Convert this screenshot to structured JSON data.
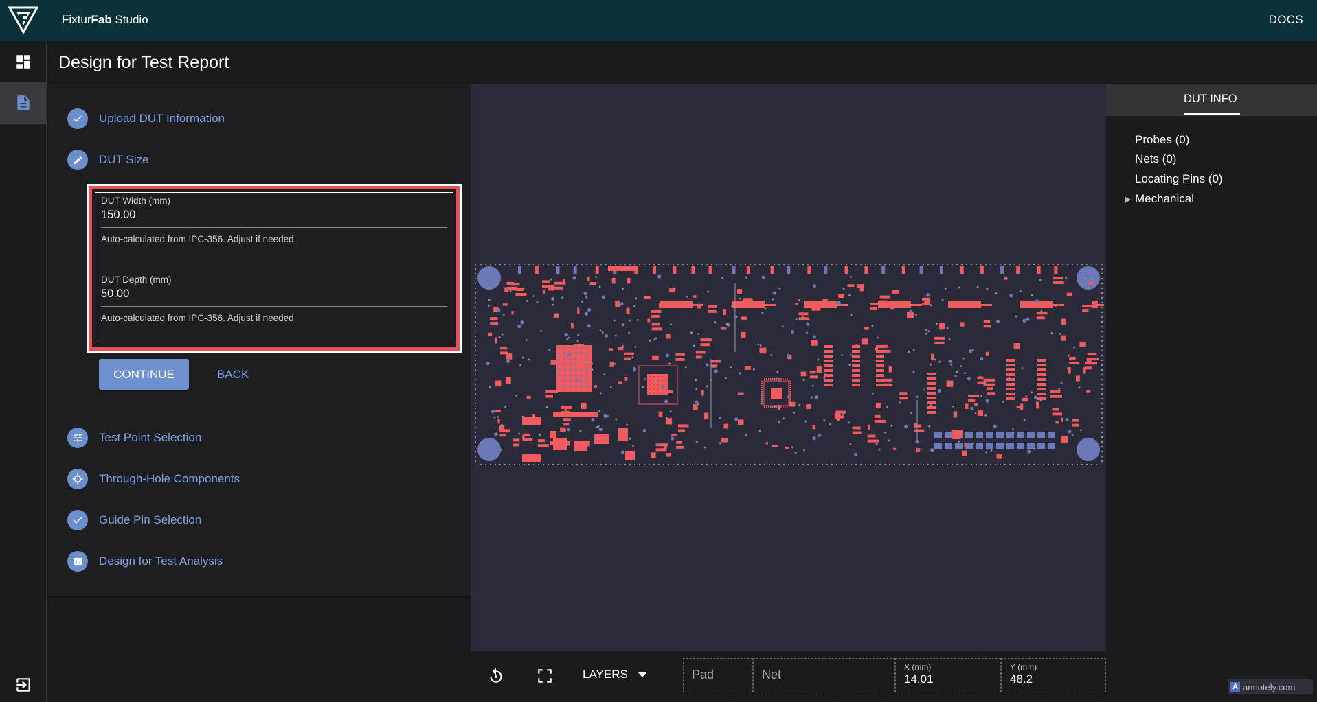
{
  "app": {
    "brand_prefix": "Fixtur",
    "brand_bold": "Fab",
    "brand_suffix": " Studio",
    "docs_label": "DOCS"
  },
  "page": {
    "title": "Design for Test Report"
  },
  "nav": {
    "items": [
      {
        "icon": "dashboard-icon"
      },
      {
        "icon": "report-icon",
        "active": true
      }
    ],
    "logout_icon": "logout-icon"
  },
  "steps": [
    {
      "label": "Upload DUT Information",
      "icon": "check-icon",
      "status": "complete"
    },
    {
      "label": "DUT Size",
      "icon": "pencil-icon",
      "status": "active"
    },
    {
      "label": "Test Point Selection",
      "icon": "sliders-icon",
      "status": "pending"
    },
    {
      "label": "Through-Hole Components",
      "icon": "target-icon",
      "status": "pending"
    },
    {
      "label": "Guide Pin Selection",
      "icon": "check-icon",
      "status": "complete"
    },
    {
      "label": "Design for Test Analysis",
      "icon": "chart-icon",
      "status": "pending"
    }
  ],
  "dut_size": {
    "width_label": "DUT Width (mm)",
    "width_value": "150.00",
    "width_help": "Auto-calculated from IPC-356. Adjust if needed.",
    "depth_label": "DUT Depth (mm)",
    "depth_value": "50.00",
    "depth_help": "Auto-calculated from IPC-356. Adjust if needed.",
    "continue_label": "CONTINUE",
    "back_label": "BACK"
  },
  "toolbar": {
    "layers_label": "LAYERS",
    "pad_placeholder": "Pad",
    "net_placeholder": "Net",
    "x_label": "X (mm)",
    "x_value": "14.01",
    "y_label": "Y (mm)",
    "y_value": "48.2"
  },
  "right_panel": {
    "tab_label": "DUT INFO",
    "items": [
      {
        "label": "Probes (0)"
      },
      {
        "label": "Nets (0)"
      },
      {
        "label": "Locating Pins (0)"
      },
      {
        "label": "Mechanical",
        "expandable": true
      }
    ]
  },
  "watermark": "annotely.com",
  "colors": {
    "topbar": "#0b3238",
    "accent": "#6c8ecb",
    "pad_red": "#ef5b5f",
    "via_blue": "#6b79b8",
    "highlight": "#e85057"
  }
}
